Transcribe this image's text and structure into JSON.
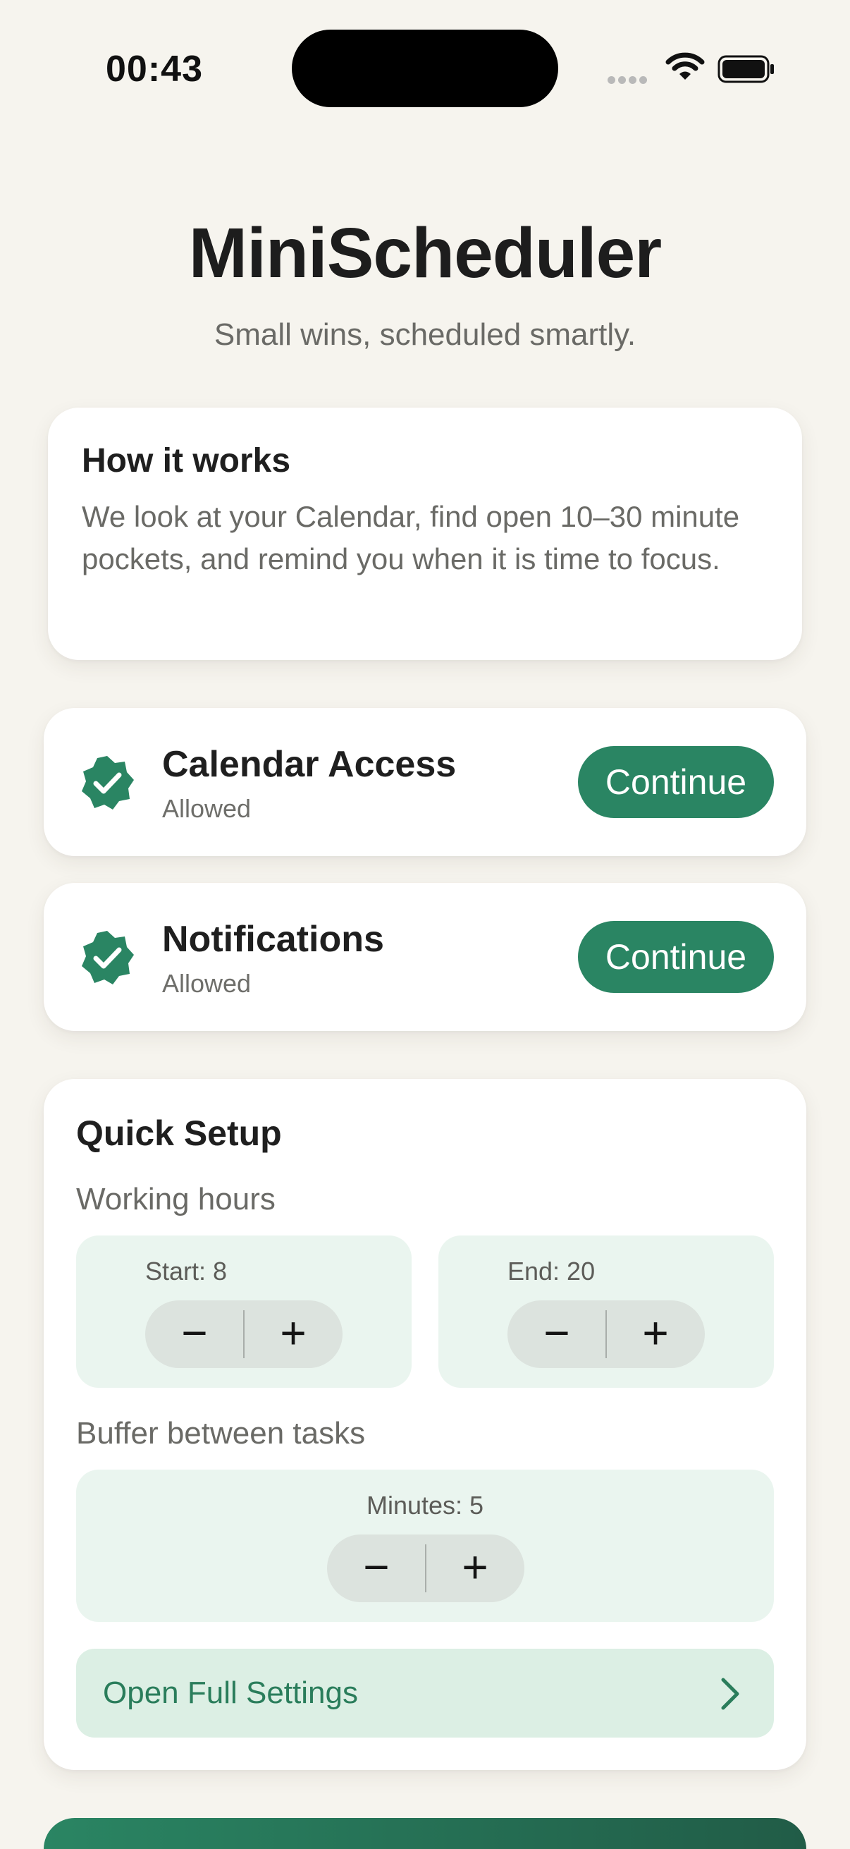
{
  "status_bar": {
    "time": "00:43",
    "wifi_icon": "wifi-icon",
    "battery_icon": "battery-icon"
  },
  "header": {
    "title": "MiniScheduler",
    "subtitle": "Small wins, scheduled smartly."
  },
  "how_it_works": {
    "title": "How it works",
    "body": "We look at your Calendar, find open 10–30 minute pockets, and remind you when it is time to focus."
  },
  "permissions": [
    {
      "name": "Calendar Access",
      "status": "Allowed",
      "button": "Continue",
      "icon": "verified-check-icon"
    },
    {
      "name": "Notifications",
      "status": "Allowed",
      "button": "Continue",
      "icon": "verified-check-icon"
    }
  ],
  "quick_setup": {
    "title": "Quick Setup",
    "working_hours_label": "Working hours",
    "start_label": "Start: 8",
    "end_label": "End: 20",
    "buffer_label": "Buffer between tasks",
    "minutes_label": "Minutes: 5",
    "minus": "−",
    "plus": "+",
    "settings_link": "Open Full Settings"
  },
  "colors": {
    "background": "#f6f4ee",
    "accent": "#2a8563",
    "stepper_panel": "#eaf5ef",
    "settings_row": "#dcefe4"
  }
}
